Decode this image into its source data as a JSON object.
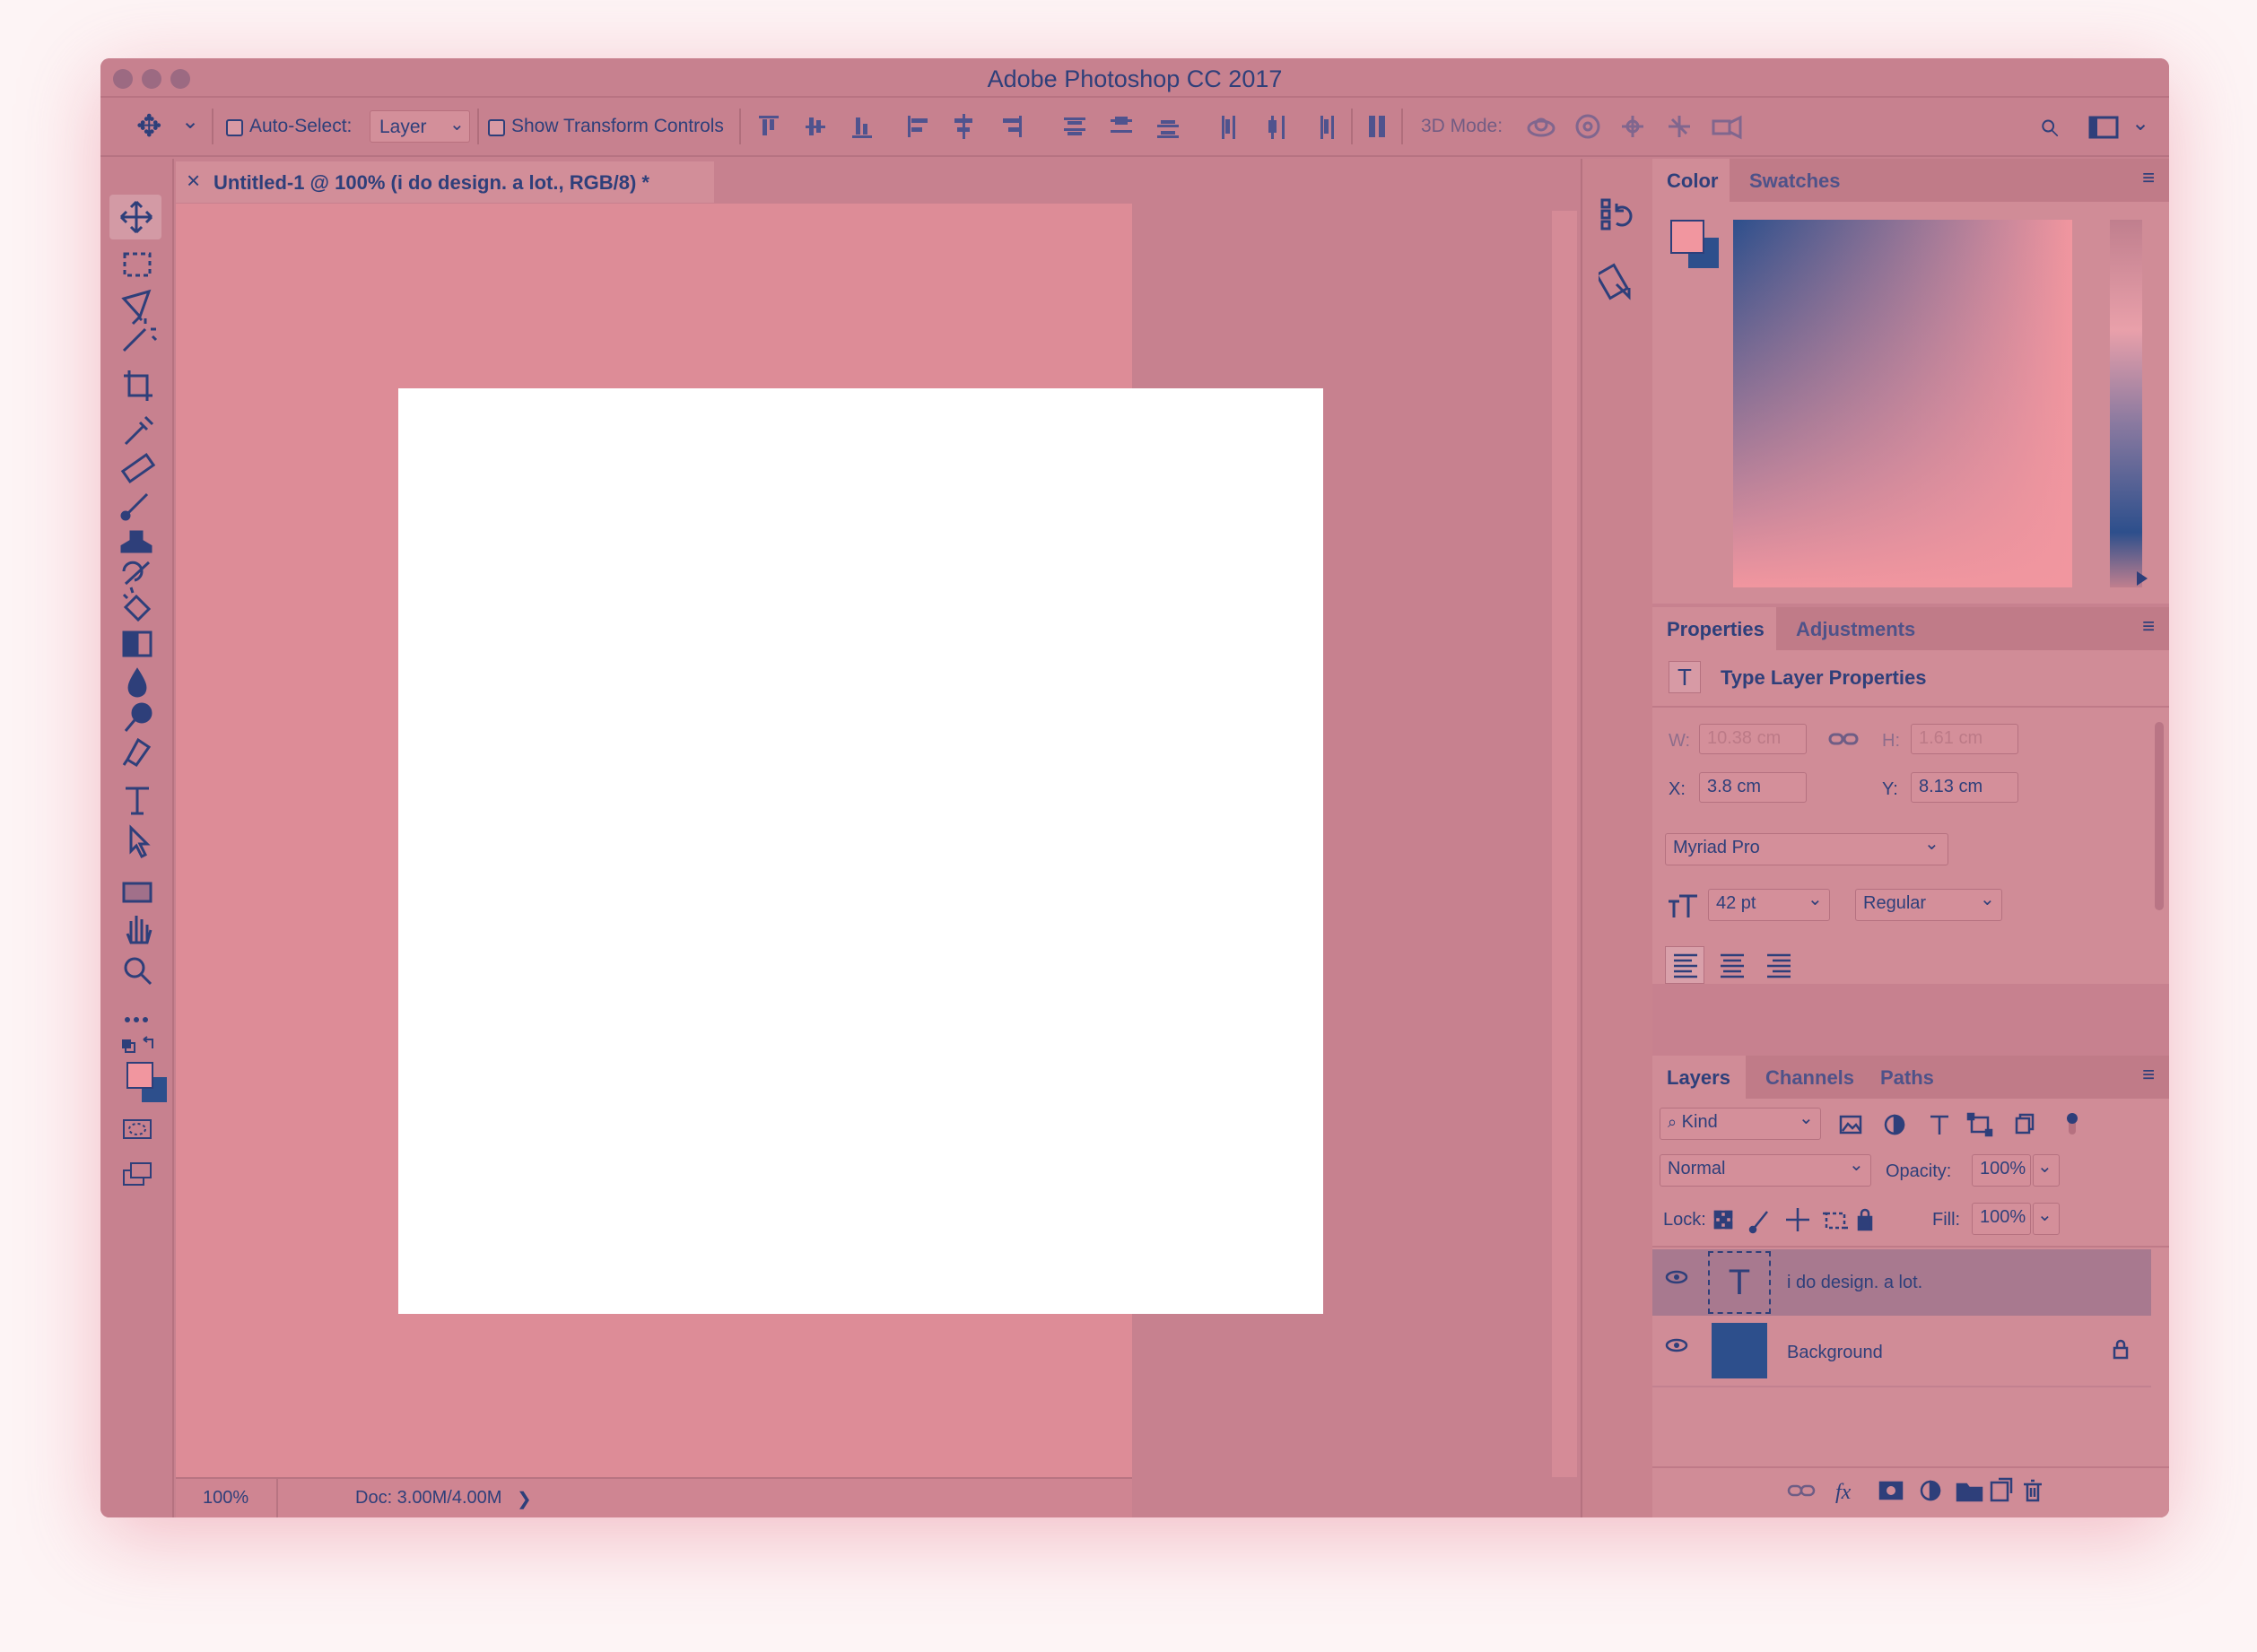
{
  "window": {
    "title": "Adobe Photoshop CC 2017"
  },
  "options_bar": {
    "auto_select_label": "Auto-Select:",
    "auto_select_value": "Layer",
    "show_transform_label": "Show Transform Controls",
    "mode_3d_label": "3D Mode:"
  },
  "document": {
    "tab_title": "Untitled-1 @ 100% (i do design. a lot., RGB/8) *",
    "close_glyph": "×"
  },
  "status": {
    "zoom": "100%",
    "doc_size": "Doc: 3.00M/4.00M",
    "arrow": "❯"
  },
  "colors": {
    "foreground": "#f1969f",
    "background": "#2d4f8c",
    "accent": "#2e3f7a"
  },
  "panels": {
    "color": {
      "tabs": [
        "Color",
        "Swatches"
      ]
    },
    "properties": {
      "tabs": [
        "Properties",
        "Adjustments"
      ],
      "heading": "Type Layer Properties",
      "w_label": "W:",
      "w_value": "10.38 cm",
      "h_label": "H:",
      "h_value": "1.61 cm",
      "x_label": "X:",
      "x_value": "3.8 cm",
      "y_label": "Y:",
      "y_value": "8.13 cm",
      "font_family": "Myriad Pro",
      "font_size": "42 pt",
      "font_style": "Regular"
    },
    "layers": {
      "tabs": [
        "Layers",
        "Channels",
        "Paths"
      ],
      "filter_kind": "Kind",
      "blend_mode": "Normal",
      "opacity_label": "Opacity:",
      "opacity_value": "100%",
      "lock_label": "Lock:",
      "fill_label": "Fill:",
      "fill_value": "100%",
      "items": [
        {
          "name": "i do design. a lot.",
          "type": "text"
        },
        {
          "name": "Background",
          "type": "fill"
        }
      ]
    }
  },
  "icons": {
    "move": "✥",
    "chevron": "⌄",
    "search": "⌕",
    "type": "T",
    "lock": "🔒",
    "eye": "👁",
    "menu": "≡",
    "ellipsis": "•••"
  }
}
